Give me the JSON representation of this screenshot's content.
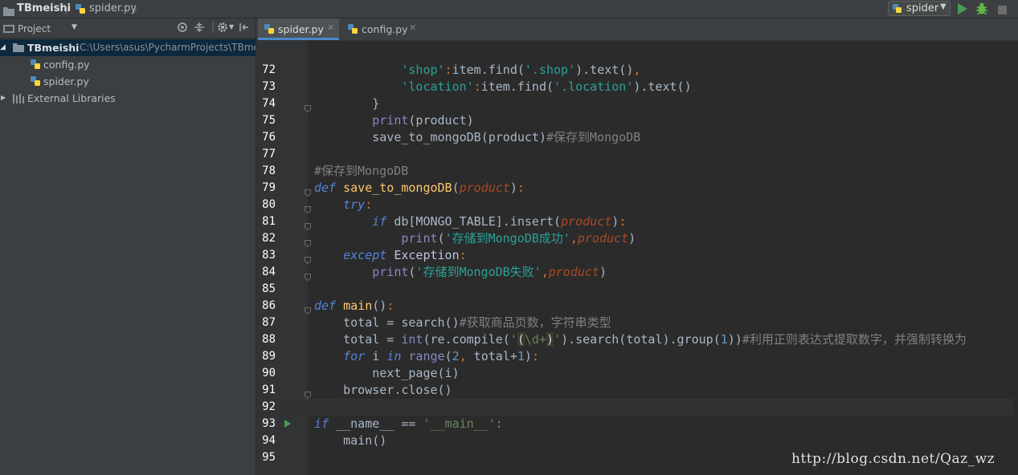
{
  "breadcrumb": {
    "project": "TBmeishi",
    "file": "spider.py"
  },
  "run_config": {
    "name": "spider"
  },
  "sidebar": {
    "header": "Project",
    "tree": [
      {
        "label": "TBmeishi",
        "path": "C:\\Users\\asus\\PycharmProjects\\TBmeishi",
        "type": "folder"
      },
      {
        "label": "config.py",
        "type": "python-file"
      },
      {
        "label": "spider.py",
        "type": "python-file"
      },
      {
        "label": "External Libraries",
        "type": "library"
      }
    ]
  },
  "tabs": [
    {
      "label": "spider.py",
      "active": true
    },
    {
      "label": "config.py",
      "active": false
    }
  ],
  "colors": {
    "keyword": "#cc7832",
    "string": "#6a8759",
    "comment": "#808080",
    "function": "#ffc66d",
    "param": "#aa4926",
    "number": "#6897bb"
  },
  "code": {
    "current_line": 92,
    "lines": [
      {
        "n": "72",
        "text": "            'shop':item.find('.shop').text(),"
      },
      {
        "n": "73",
        "text": "            'location':item.find('.location').text()"
      },
      {
        "n": "74",
        "text": "        }"
      },
      {
        "n": "75",
        "text": "        print(product)"
      },
      {
        "n": "76",
        "text": "        save_to_mongoDB(product)#保存到MongoDB"
      },
      {
        "n": "77",
        "text": ""
      },
      {
        "n": "78",
        "text": "#保存到MongoDB"
      },
      {
        "n": "79",
        "text": "def save_to_mongoDB(product):"
      },
      {
        "n": "80",
        "text": "    try:"
      },
      {
        "n": "81",
        "text": "        if db[MONGO_TABLE].insert(product):"
      },
      {
        "n": "82",
        "text": "            print('存储到MongoDB成功',product)"
      },
      {
        "n": "83",
        "text": "    except Exception:"
      },
      {
        "n": "84",
        "text": "        print('存储到MongoDB失败',product)"
      },
      {
        "n": "85",
        "text": ""
      },
      {
        "n": "86",
        "text": "def main():"
      },
      {
        "n": "87",
        "text": "    total = search()#获取商品页数，字符串类型"
      },
      {
        "n": "88",
        "text": "    total = int(re.compile('(\\d+)').search(total).group(1))#利用正则表达式提取数字，并强制转换为"
      },
      {
        "n": "89",
        "text": "    for i in range(2, total+1):"
      },
      {
        "n": "90",
        "text": "        next_page(i)"
      },
      {
        "n": "91",
        "text": "    browser.close()"
      },
      {
        "n": "92",
        "text": ""
      },
      {
        "n": "93",
        "text": "if __name__ == '__main__':"
      },
      {
        "n": "94",
        "text": "    main()"
      },
      {
        "n": "95",
        "text": ""
      }
    ]
  },
  "watermark": "http://blog.csdn.net/Qaz_wz"
}
